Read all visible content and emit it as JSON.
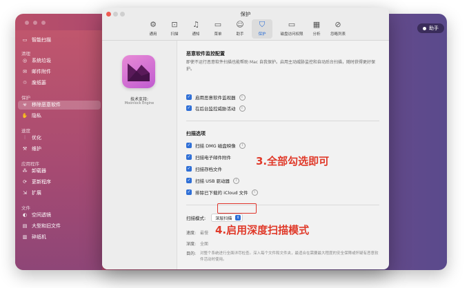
{
  "background_window": {
    "assistant_label": "助手",
    "sidebar": {
      "top_item": "智能扫描",
      "sections": [
        {
          "title": "清理",
          "items": [
            "系统垃圾",
            "邮件附件",
            "废纸篓"
          ]
        },
        {
          "title": "保护",
          "items": [
            "移除恶意软件",
            "隐私"
          ]
        },
        {
          "title": "速度",
          "items": [
            "优化",
            "维护"
          ]
        },
        {
          "title": "应用程序",
          "items": [
            "卸载器",
            "更新程序",
            "扩展"
          ]
        },
        {
          "title": "文件",
          "items": [
            "空间透镜",
            "大型和旧文件",
            "碎纸机"
          ]
        }
      ],
      "active_item": "移除恶意软件"
    }
  },
  "dialog": {
    "title": "保护",
    "tabs": [
      {
        "label": "通用",
        "icon": "gear-icon"
      },
      {
        "label": "扫描",
        "icon": "scan-icon"
      },
      {
        "label": "通知",
        "icon": "bell-icon"
      },
      {
        "label": "菜单",
        "icon": "menu-icon"
      },
      {
        "label": "助手",
        "icon": "assistant-icon"
      },
      {
        "label": "保护",
        "icon": "shield-icon"
      },
      {
        "label": "磁盘访问权限",
        "icon": "disk-icon"
      },
      {
        "label": "分析",
        "icon": "chart-icon"
      },
      {
        "label": "忽略列表",
        "icon": "block-icon"
      }
    ],
    "selected_tab": "保护",
    "engine": {
      "line1": "技术支持:",
      "line2": "Moonlock Engine"
    },
    "monitor": {
      "heading": "恶意软件监控配置",
      "description": "即使不运行恶意软件扫描也能帮助 Mac 自我保护。启用主动威胁监控和自动后台扫描，随时获得更好保护。",
      "options": [
        {
          "label": "启用恶意软件监视器",
          "checked": true
        },
        {
          "label": "在后台监控威胁活动",
          "checked": true
        }
      ]
    },
    "scan_options": {
      "heading": "扫描选项",
      "options": [
        {
          "label": "扫描 DMG 磁盘映像",
          "checked": true
        },
        {
          "label": "扫描电子邮件附件",
          "checked": true
        },
        {
          "label": "扫描存档文件",
          "checked": true
        },
        {
          "label": "扫描 USB 驱动器",
          "checked": true
        },
        {
          "label": "排除已下载的 iCloud 文件",
          "checked": true
        }
      ]
    },
    "scan_mode": {
      "label": "扫描模式:",
      "value": "深层扫描",
      "speed_label": "速度:",
      "speed_value": "最慢",
      "depth_label": "深度:",
      "depth_value": "全面",
      "purpose_label": "目的:",
      "purpose_value": "对整个系统进行全面详尽检查。深入每个文件和文件夹，最适合在需要最大程度的安全保障或怀疑有恶意软件活动时使用。"
    }
  },
  "annotations": {
    "note1": "3.全部勾选即可",
    "note2": "4.启用深度扫描模式",
    "color": "#e03a2a"
  }
}
